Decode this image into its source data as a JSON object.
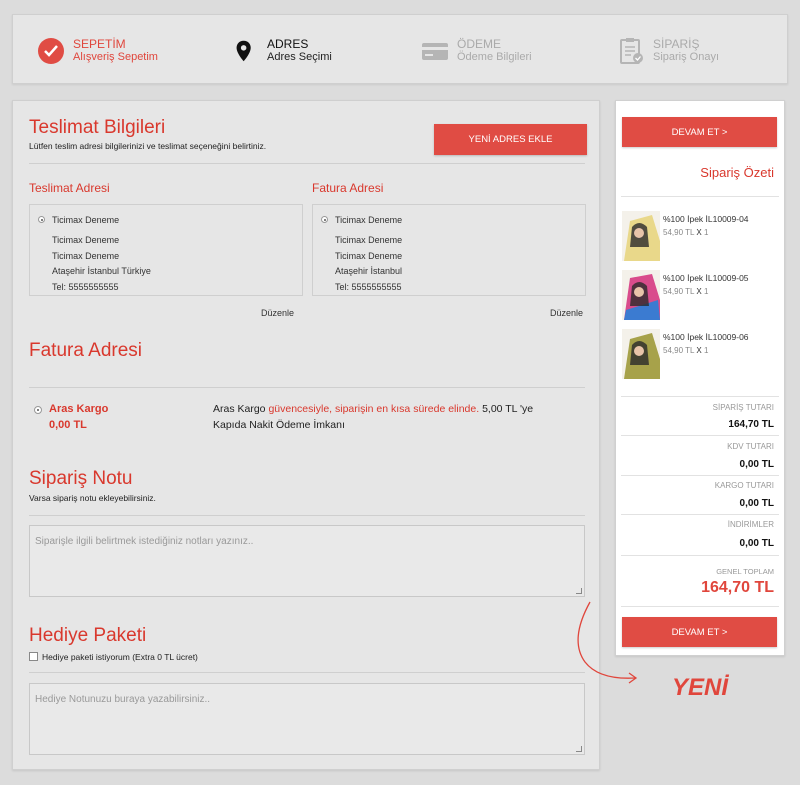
{
  "steps": [
    {
      "title": "SEPETİM",
      "sub": "Alışveriş Sepetim",
      "icon": "check-circle-icon"
    },
    {
      "title": "ADRES",
      "sub": "Adres Seçimi",
      "icon": "map-pin-icon"
    },
    {
      "title": "ÖDEME",
      "sub": "Ödeme Bilgileri",
      "icon": "credit-card-icon"
    },
    {
      "title": "SİPARİŞ",
      "sub": "Sipariş Onayı",
      "icon": "clipboard-check-icon"
    }
  ],
  "delivery": {
    "title": "Teslimat Bilgileri",
    "subtitle": "Lütfen teslim adresi bilgilerinizi ve teslimat seçeneğini belirtiniz.",
    "add_button": "YENİ ADRES EKLE",
    "shipping_label": "Teslimat Adresi",
    "billing_label": "Fatura Adresi",
    "shipping_address": {
      "name": "Ticimax Deneme",
      "l1": "Ticimax Deneme",
      "l2": "Ticimax Deneme",
      "l3": "Ataşehir İstanbul Türkiye",
      "l4": "Tel: 5555555555"
    },
    "billing_address": {
      "name": "Ticimax Deneme",
      "l1": "Ticimax Deneme",
      "l2": "Ticimax Deneme",
      "l3": "Ataşehir İstanbul",
      "l4": "Tel: 5555555555"
    },
    "edit_label": "Düzenle"
  },
  "cargo": {
    "title": "Fatura Adresi",
    "name": "Aras Kargo",
    "price": "0,00 TL",
    "desc1": "Aras Kargo",
    "desc_red": "güvencesiyle, siparişin en kısa sürede elinde.",
    "desc_price": "5,00 TL",
    "desc_suffix": "'ye",
    "desc2": "Kapıda Nakit Ödeme İmkanı"
  },
  "note": {
    "title": "Sipariş Notu",
    "subtitle": "Varsa sipariş notu ekleyebilirsiniz.",
    "placeholder": "Siparişle ilgili belirtmek istediğiniz notları yazınız.."
  },
  "gift": {
    "title": "Hediye Paketi",
    "checkbox_label": "Hediye paketi istiyorum (Extra 0 TL ücret)",
    "placeholder": "Hediye Notunuzu buraya yazabilirsiniz.."
  },
  "summary": {
    "continue_label": "DEVAM ET >",
    "title": "Sipariş Özeti",
    "items": [
      {
        "name": "%100 İpek İL10009-04",
        "price": "54,90 TL",
        "x": "X",
        "qty": "1"
      },
      {
        "name": "%100 İpek İL10009-05",
        "price": "54,90 TL",
        "x": "X",
        "qty": "1"
      },
      {
        "name": "%100 İpek İL10009-06",
        "price": "54,90 TL",
        "x": "X",
        "qty": "1"
      }
    ],
    "order_total_label": "SİPARİŞ TUTARI",
    "order_total": "164,70 TL",
    "kdv_label": "KDV TUTARI",
    "kdv": "0,00 TL",
    "cargo_label": "KARGO TUTARI",
    "cargo": "0,00 TL",
    "discount_label": "İNDİRİMLER",
    "discount": "0,00 TL",
    "grand_label": "GENEL TOPLAM",
    "grand": "164,70 TL"
  },
  "annotation": {
    "text": "YENİ"
  },
  "colors": {
    "accent": "#e04c44",
    "text_red": "#d9382d"
  }
}
